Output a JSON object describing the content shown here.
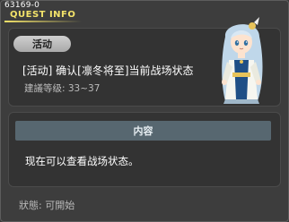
{
  "window": {
    "quest_id": "63169-0",
    "title": "QUEST INFO"
  },
  "info": {
    "badge": "活动",
    "quest_name": "[活动] 确认[凛冬将至]当前战场状态",
    "recommend_level": "建議等级: 33~37"
  },
  "content": {
    "header": "内容",
    "text": "现在可以查看战场状态。"
  },
  "status": {
    "text": "狀態: 可開始"
  },
  "colors": {
    "title_accent": "#f3e36a",
    "content_header_bg": "#576770",
    "panel_bg": "#333333",
    "window_bg": "#3d3d3d"
  },
  "icons": {
    "portrait": "npc-portrait-icon"
  }
}
